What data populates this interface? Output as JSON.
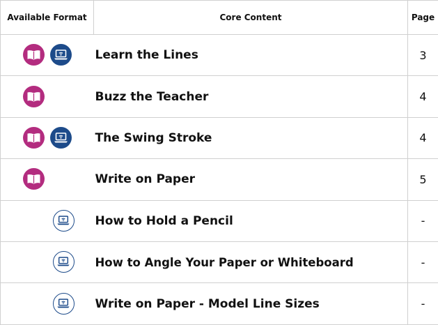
{
  "header": {
    "col_format": "Available Format",
    "col_content": "Core Content",
    "col_page": "Page"
  },
  "colors": {
    "book_icon": "#b32c7f",
    "laptop_icon": "#1d4b8a"
  },
  "rows": [
    {
      "content": "Learn the Lines",
      "page": "3",
      "formats": [
        "book-icon",
        "laptop-icon-filled"
      ]
    },
    {
      "content": "Buzz the Teacher",
      "page": "4",
      "formats": [
        "book-icon"
      ]
    },
    {
      "content": "The Swing Stroke",
      "page": "4",
      "formats": [
        "book-icon",
        "laptop-icon-filled"
      ]
    },
    {
      "content": "Write on Paper",
      "page": "5",
      "formats": [
        "book-icon"
      ]
    },
    {
      "content": "How to Hold a Pencil",
      "page": "-",
      "formats": [
        "laptop-icon-outline"
      ]
    },
    {
      "content": "How to Angle Your Paper or Whiteboard",
      "page": "-",
      "formats": [
        "laptop-icon-outline"
      ]
    },
    {
      "content": "Write on Paper - Model Line Sizes",
      "page": "-",
      "formats": [
        "laptop-icon-outline"
      ]
    }
  ]
}
